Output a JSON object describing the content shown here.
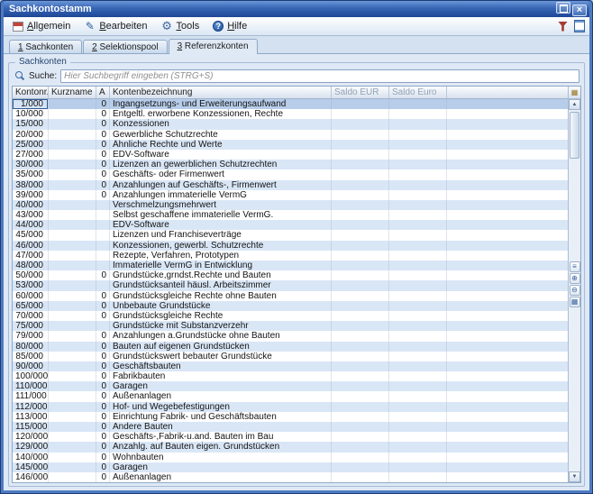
{
  "titlebar": {
    "title": "Sachkontostamm",
    "buttons": [
      "window-icon",
      "close-icon"
    ]
  },
  "toolbar": {
    "buttons": [
      {
        "label": "Allgemein",
        "icon": "window"
      },
      {
        "label": "Bearbeiten",
        "icon": "pencil"
      },
      {
        "label": "Tools",
        "icon": "gear"
      },
      {
        "label": "Hilfe",
        "icon": "help"
      }
    ],
    "right_icons": [
      "funnel",
      "document"
    ]
  },
  "tabs": [
    {
      "label": "1 Sachkonten",
      "active": false
    },
    {
      "label": "2 Selektionspool",
      "active": false
    },
    {
      "label": "3 Referenzkonten",
      "active": true
    }
  ],
  "groupbox": {
    "label": "Sachkonten"
  },
  "search": {
    "label": "Suche:",
    "placeholder": "Hier Suchbegriff eingeben (STRG+S)"
  },
  "table": {
    "columns": [
      {
        "label": "Kontonr.",
        "sort": "asc"
      },
      {
        "label": "Kurzname"
      },
      {
        "label": "A"
      },
      {
        "label": "Kontenbezeichnung"
      },
      {
        "label": "Saldo EUR",
        "muted": true
      },
      {
        "label": "Saldo Euro",
        "muted": true
      }
    ],
    "selected_index": 0,
    "rows": [
      [
        "1/000",
        "",
        "0",
        "Ingangsetzungs- und Erweiterungsaufwand",
        "",
        ""
      ],
      [
        "10/000",
        "",
        "0",
        "Entgeltl. erworbene Konzessionen, Rechte",
        "",
        ""
      ],
      [
        "15/000",
        "",
        "0",
        "Konzessionen",
        "",
        ""
      ],
      [
        "20/000",
        "",
        "0",
        "Gewerbliche Schutzrechte",
        "",
        ""
      ],
      [
        "25/000",
        "",
        "0",
        "Ähnliche Rechte und Werte",
        "",
        ""
      ],
      [
        "27/000",
        "",
        "0",
        "EDV-Software",
        "",
        ""
      ],
      [
        "30/000",
        "",
        "0",
        "Lizenzen an gewerblichen Schutzrechten",
        "",
        ""
      ],
      [
        "35/000",
        "",
        "0",
        "Geschäfts- oder Firmenwert",
        "",
        ""
      ],
      [
        "38/000",
        "",
        "0",
        "Anzahlungen auf Geschäfts-, Firmenwert",
        "",
        ""
      ],
      [
        "39/000",
        "",
        "0",
        "Anzahlungen immaterielle VermG",
        "",
        ""
      ],
      [
        "40/000",
        "",
        "",
        "Verschmelzungsmehrwert",
        "",
        ""
      ],
      [
        "43/000",
        "",
        "",
        "Selbst geschaffene immaterielle VermG.",
        "",
        ""
      ],
      [
        "44/000",
        "",
        "",
        "EDV-Software",
        "",
        ""
      ],
      [
        "45/000",
        "",
        "",
        "Lizenzen und Franchiseverträge",
        "",
        ""
      ],
      [
        "46/000",
        "",
        "",
        "Konzessionen, gewerbl. Schutzrechte",
        "",
        ""
      ],
      [
        "47/000",
        "",
        "",
        "Rezepte, Verfahren, Prototypen",
        "",
        ""
      ],
      [
        "48/000",
        "",
        "",
        "Immaterielle VermG in Entwicklung",
        "",
        ""
      ],
      [
        "50/000",
        "",
        "0",
        "Grundstücke,grndst.Rechte und Bauten",
        "",
        ""
      ],
      [
        "53/000",
        "",
        "",
        "Grundstücksanteil häusl. Arbeitszimmer",
        "",
        ""
      ],
      [
        "60/000",
        "",
        "0",
        "Grundstücksgleiche Rechte ohne Bauten",
        "",
        ""
      ],
      [
        "65/000",
        "",
        "0",
        "Unbebaute Grundstücke",
        "",
        ""
      ],
      [
        "70/000",
        "",
        "0",
        "Grundstücksgleiche Rechte",
        "",
        ""
      ],
      [
        "75/000",
        "",
        "",
        "Grundstücke mit Substanzverzehr",
        "",
        ""
      ],
      [
        "79/000",
        "",
        "0",
        "Anzahlungen a.Grundstücke ohne Bauten",
        "",
        ""
      ],
      [
        "80/000",
        "",
        "0",
        "Bauten auf eigenen Grundstücken",
        "",
        ""
      ],
      [
        "85/000",
        "",
        "0",
        "Grundstückswert bebauter Grundstücke",
        "",
        ""
      ],
      [
        "90/000",
        "",
        "0",
        "Geschäftsbauten",
        "",
        ""
      ],
      [
        "100/000",
        "",
        "0",
        "Fabrikbauten",
        "",
        ""
      ],
      [
        "110/000",
        "",
        "0",
        "Garagen",
        "",
        ""
      ],
      [
        "111/000",
        "",
        "0",
        "Außenanlagen",
        "",
        ""
      ],
      [
        "112/000",
        "",
        "0",
        "Hof- und Wegebefestigungen",
        "",
        ""
      ],
      [
        "113/000",
        "",
        "0",
        "Einrichtung Fabrik- und Geschäftsbauten",
        "",
        ""
      ],
      [
        "115/000",
        "",
        "0",
        "Andere Bauten",
        "",
        ""
      ],
      [
        "120/000",
        "",
        "0",
        "Geschäfts-,Fabrik-u.and. Bauten im Bau",
        "",
        ""
      ],
      [
        "129/000",
        "",
        "0",
        "Anzahlg. auf Bauten eigen. Grundstücken",
        "",
        ""
      ],
      [
        "140/000",
        "",
        "0",
        "Wohnbauten",
        "",
        ""
      ],
      [
        "145/000",
        "",
        "0",
        "Garagen",
        "",
        ""
      ],
      [
        "146/000",
        "",
        "0",
        "Außenanlagen",
        "",
        ""
      ]
    ]
  },
  "side_buttons": [
    "menu-icon",
    "zoom-in-icon",
    "zoom-out-icon",
    "columns-icon"
  ],
  "colors": {
    "titlebar_blue": "#2c5cae",
    "frame_blue": "#4e7bc0",
    "panel": "#dfe9f5",
    "row_alt": "#d9e6f6",
    "row_selected": "#b7cde9",
    "muted_header": "#92a1b5"
  }
}
